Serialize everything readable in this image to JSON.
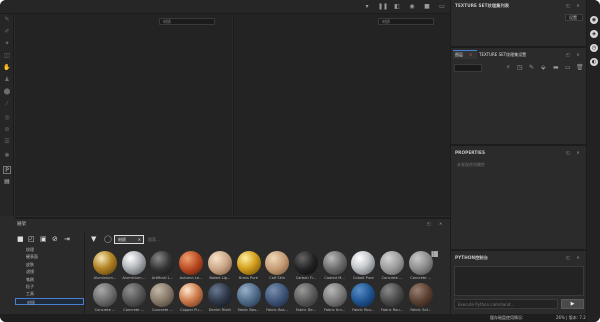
{
  "top_bar": {
    "icons": [
      "pause-icon",
      "camera-icon",
      "sphere-icon",
      "video-icon",
      "fit-icon"
    ]
  },
  "viewport_left": {
    "mode_select": "材质"
  },
  "viewport_right": {
    "mode_select": "材质"
  },
  "texture_set_list": {
    "title": "TEXTURE SET纹理集列表",
    "settings_label": "设置"
  },
  "layers": {
    "tab_layer": "图层",
    "tab_texture_set_settings": "TEXTURE SET纹理集设置"
  },
  "properties": {
    "title": "PROPERTIES",
    "empty_message": "未发现任何属性"
  },
  "python_console": {
    "title": "PYTHON控制台",
    "input_placeholder": "Execute Python command..."
  },
  "shelf": {
    "title": "展架",
    "filter_tag": "材质",
    "search_placeholder": "搜索...",
    "categories": [
      "纹理",
      "硬表面",
      "皮肤",
      "滤镜",
      "笔刷",
      "粒子",
      "工具",
      "材质"
    ],
    "selected_category": "材质",
    "materials_row1": [
      "Aluminium...",
      "Aluminium...",
      "Artificial L...",
      "Autumn Le...",
      "Baked Lig...",
      "Brass Pure",
      "Calf Skin",
      "Carbon Fi...",
      "Coated M...",
      "Cobalt Pure",
      "Concrete ...",
      "Concrete ..."
    ],
    "materials_row2": [
      "Concrete ...",
      "Concrete ...",
      "Concrete ...",
      "Copper Pu...",
      "Denim Rivet",
      "Fabric Bas...",
      "Fabric Bas...",
      "Fabric De...",
      "Fabric Kni...",
      "Fabric Rou...",
      "Fabric Rou...",
      "Fabric Sof..."
    ]
  },
  "status_bar": {
    "text": "缓存磁盘使用情况:",
    "value": "26% | 版本: 7.2"
  }
}
